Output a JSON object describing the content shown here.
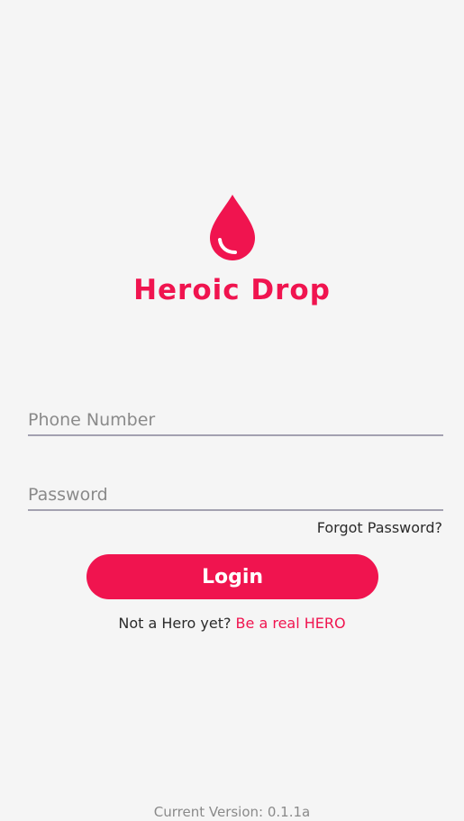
{
  "logo": {
    "icon": "blood-drop-icon",
    "app_name": "Heroic Drop"
  },
  "form": {
    "phone_placeholder": "Phone Number",
    "password_placeholder": "Password",
    "forgot_password": "Forgot Password?",
    "login_label": "Login"
  },
  "signup": {
    "prompt": "Not a Hero yet? ",
    "link": "Be a real HERO"
  },
  "footer": {
    "version": "Current Version: 0.1.1a"
  },
  "colors": {
    "accent": "#f0144f",
    "background": "#f5f5f5",
    "underline": "#a3a1b0"
  }
}
